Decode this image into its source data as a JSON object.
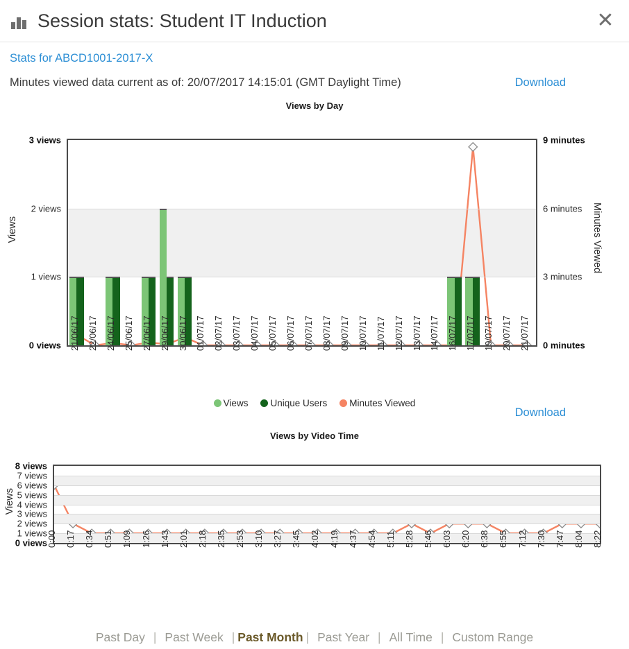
{
  "dialog": {
    "title": "Session stats: Student IT Induction",
    "icon": "bar-chart-icon",
    "close_label": "✕"
  },
  "subheader": {
    "stats_for_link": "Stats for ABCD1001-2017-X",
    "as_of_text": "Minutes viewed data current as of: 20/07/2017 14:15:01 (GMT Daylight Time)",
    "download_top": "Download",
    "download_middle": "Download"
  },
  "legend": {
    "views": "Views",
    "unique_users": "Unique Users",
    "minutes_viewed": "Minutes Viewed"
  },
  "colors": {
    "views": "#7cc576",
    "unique_users": "#14631c",
    "minutes": "#f58463",
    "link": "#2d8fd5",
    "active_range": "#6b5a2a",
    "band": "#f0f0f0"
  },
  "footer": {
    "ranges": [
      {
        "label": "Past Day",
        "active": false
      },
      {
        "label": "Past Week",
        "active": false
      },
      {
        "label": "Past Month",
        "active": true
      },
      {
        "label": "Past Year",
        "active": false
      },
      {
        "label": "All Time",
        "active": false
      },
      {
        "label": "Custom Range",
        "active": false
      }
    ],
    "separator": "|"
  },
  "chart_data": [
    {
      "type": "bar",
      "title": "Views by Day",
      "xlabel": "",
      "ylabel": "Views",
      "y2label": "Minutes Viewed",
      "ylim": [
        0,
        3
      ],
      "y2lim": [
        0,
        9
      ],
      "yticks": [
        "0 views",
        "1 views",
        "2 views",
        "3 views"
      ],
      "y2ticks": [
        "0 minutes",
        "3 minutes",
        "6 minutes",
        "9 minutes"
      ],
      "grid": true,
      "legend_position": "bottom",
      "categories": [
        "21/06/17",
        "22/06/17",
        "24/06/17",
        "25/06/17",
        "27/06/17",
        "29/06/17",
        "30/06/17",
        "01/07/17",
        "02/07/17",
        "03/07/17",
        "04/07/17",
        "05/07/17",
        "06/07/17",
        "07/07/17",
        "08/07/17",
        "09/07/17",
        "10/07/17",
        "11/07/17",
        "12/07/17",
        "13/07/17",
        "14/07/17",
        "16/07/17",
        "17/07/17",
        "19/07/17",
        "20/07/17",
        "21/07/17"
      ],
      "series": [
        {
          "name": "Views",
          "kind": "bar",
          "values": [
            1,
            0,
            1,
            0,
            1,
            2,
            1,
            0,
            0,
            0,
            0,
            0,
            0,
            0,
            0,
            0,
            0,
            0,
            0,
            0,
            0,
            1,
            1,
            0,
            0,
            0
          ]
        },
        {
          "name": "Unique Users",
          "kind": "bar",
          "values": [
            1,
            0,
            1,
            0,
            1,
            1,
            1,
            0,
            0,
            0,
            0,
            0,
            0,
            0,
            0,
            0,
            0,
            0,
            0,
            0,
            0,
            1,
            1,
            0,
            0,
            0
          ]
        },
        {
          "name": "Minutes Viewed",
          "kind": "line",
          "values": [
            0.45,
            0,
            0.1,
            0,
            0.12,
            0.05,
            0.35,
            0,
            0,
            0,
            0,
            0,
            0,
            0,
            0,
            0,
            0,
            0,
            0,
            0,
            0,
            0,
            8.7,
            0,
            0,
            0
          ]
        }
      ]
    },
    {
      "type": "line",
      "title": "Views by Video Time",
      "xlabel": "",
      "ylabel": "Views",
      "ylim": [
        0,
        8
      ],
      "yticks": [
        "0 views",
        "1 views",
        "2 views",
        "3 views",
        "4 views",
        "5 views",
        "6 views",
        "7 views",
        "8 views"
      ],
      "grid": true,
      "categories": [
        "0:00",
        "0:17",
        "0:34",
        "0:51",
        "1:09",
        "1:26",
        "1:43",
        "2:01",
        "2:18",
        "2:35",
        "2:53",
        "3:10",
        "3:27",
        "3:45",
        "4:02",
        "4:19",
        "4:37",
        "4:54",
        "5:11",
        "5:28",
        "5:46",
        "6:03",
        "6:20",
        "6:38",
        "6:55",
        "7:12",
        "7:30",
        "7:47",
        "8:04",
        "8:22"
      ],
      "series": [
        {
          "name": "Views",
          "kind": "line",
          "values": [
            6,
            2,
            1,
            1,
            1,
            1,
            1,
            1,
            1,
            1,
            1,
            1,
            1,
            1,
            1,
            1,
            1,
            1,
            1,
            2,
            1,
            2,
            2,
            2,
            1,
            1,
            1,
            2,
            2,
            2
          ]
        }
      ]
    }
  ]
}
